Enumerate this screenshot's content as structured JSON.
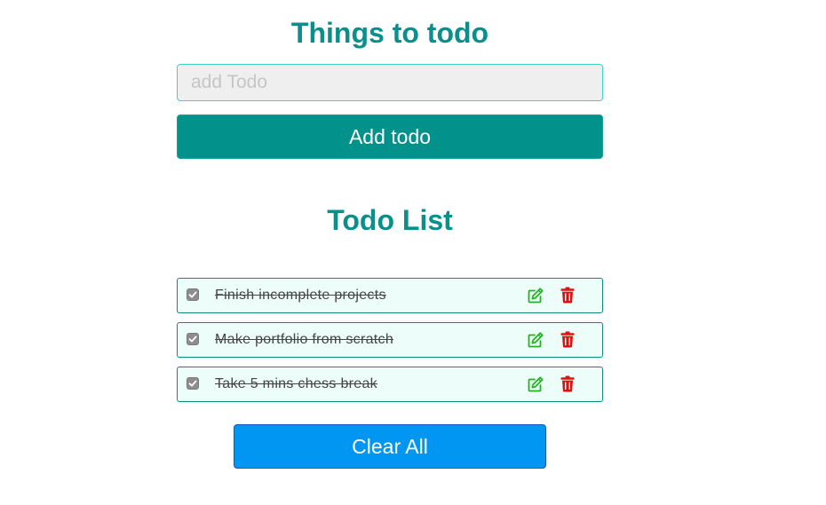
{
  "header": {
    "title": "Things to todo"
  },
  "input": {
    "placeholder": "add Todo",
    "value": ""
  },
  "add_button": {
    "label": "Add todo"
  },
  "list": {
    "title": "Todo List",
    "items": [
      {
        "text": "Finish incomplete projects",
        "completed": true,
        "edit_icon": "edit-icon",
        "delete_icon": "trash-icon"
      },
      {
        "text": "Make portfolio from scratch",
        "completed": true,
        "edit_icon": "edit-icon",
        "delete_icon": "trash-icon"
      },
      {
        "text": "Take 5 mins chess break",
        "completed": true,
        "edit_icon": "edit-icon",
        "delete_icon": "trash-icon"
      }
    ]
  },
  "clear_button": {
    "label": "Clear All"
  },
  "colors": {
    "heading": "#0a8f8a",
    "add_button": "#03918b",
    "clear_button": "#0296f3",
    "edit_icon": "#22b322",
    "delete_icon": "#e01010",
    "item_background": "#edfdf9"
  }
}
